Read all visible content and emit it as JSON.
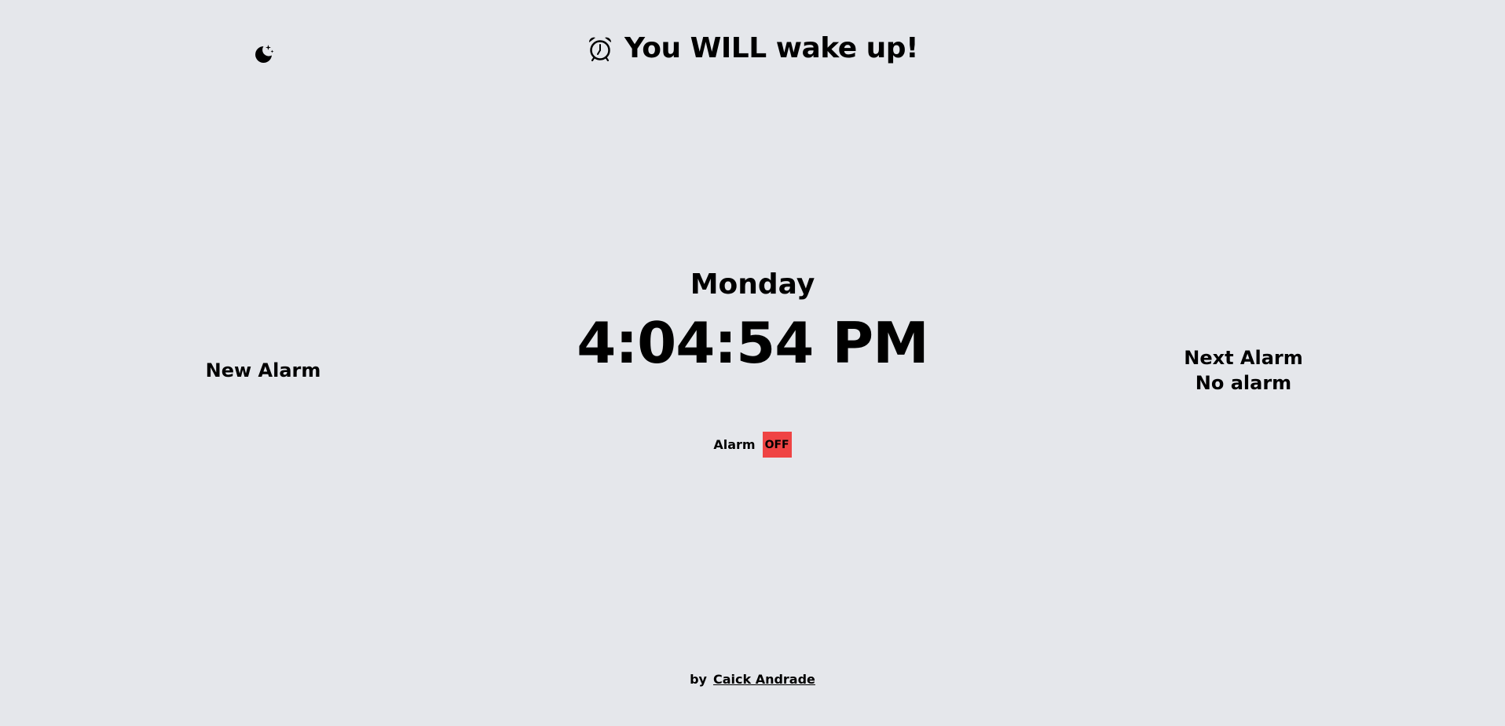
{
  "header": {
    "title": "You WILL wake up!",
    "icon": "alarm-clock-icon"
  },
  "theme_toggle": {
    "icon": "moon-stars-icon"
  },
  "clock": {
    "day": "Monday",
    "time": "4:04:54 PM"
  },
  "new_alarm": {
    "label": "New Alarm"
  },
  "next_alarm": {
    "label": "Next Alarm",
    "value": "No alarm"
  },
  "alarm_toggle": {
    "label": "Alarm",
    "state": "OFF",
    "state_color": "#ef4444"
  },
  "footer": {
    "by": "by",
    "author": "Caick Andrade"
  },
  "colors": {
    "background": "#e5e7eb",
    "text": "#000000"
  }
}
